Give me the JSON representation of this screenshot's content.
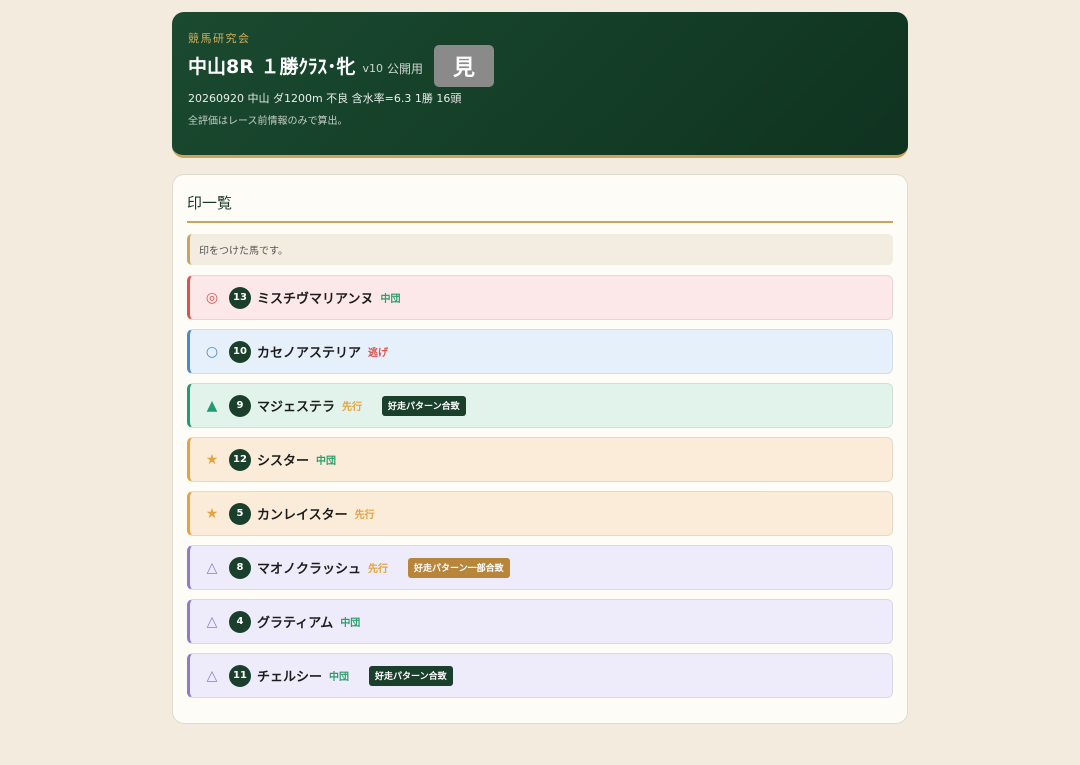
{
  "header": {
    "site_name": "競馬研究会",
    "race_title": "中山8R １勝ｸﾗｽ･牝",
    "version": "v10",
    "visibility": "公開用",
    "view_button_label": "見",
    "race_info": "20260920 中山 ダ1200m 不良 含水率=6.3 1勝 16頭",
    "note": "全評価はレース前情報のみで算出。"
  },
  "marks_section": {
    "title": "印一覧",
    "notice": "印をつけた馬です。"
  },
  "horses": [
    {
      "mark": "◎",
      "number": "13",
      "name": "ミスチヴマリアンヌ",
      "style": "中団",
      "tag": "",
      "mark_color": "#d9534f",
      "style_color": "#2e9e6b",
      "bg": "#fce8e8",
      "border": "#d9534f",
      "tag_color": ""
    },
    {
      "mark": "○",
      "number": "10",
      "name": "カセノアステリア",
      "style": "逃げ",
      "tag": "",
      "mark_color": "#4a89c8",
      "style_color": "#d9534f",
      "bg": "#e6f0fa",
      "border": "#4a89c8",
      "tag_color": ""
    },
    {
      "mark": "▲",
      "number": "9",
      "name": "マジェステラ",
      "style": "先行",
      "tag": "好走パターン合致",
      "mark_color": "#229a73",
      "style_color": "#e6a23c",
      "bg": "#e2f3ec",
      "border": "#229a73",
      "tag_color": "#1a3f2b"
    },
    {
      "mark": "★",
      "number": "12",
      "name": "シスター",
      "style": "中団",
      "tag": "",
      "mark_color": "#e6a23c",
      "style_color": "#2e9e6b",
      "bg": "#faecd9",
      "border": "#e6a23c",
      "tag_color": ""
    },
    {
      "mark": "★",
      "number": "5",
      "name": "カンレイスター",
      "style": "先行",
      "tag": "",
      "mark_color": "#e6a23c",
      "style_color": "#e6a23c",
      "bg": "#faecd9",
      "border": "#e6a23c",
      "tag_color": ""
    },
    {
      "mark": "△",
      "number": "8",
      "name": "マオノクラッシュ",
      "style": "先行",
      "tag": "好走パターン一部合致",
      "mark_color": "#8a7dc8",
      "style_color": "#e6a23c",
      "bg": "#eeebfa",
      "border": "#8a7dc8",
      "tag_color": "#b8863b"
    },
    {
      "mark": "△",
      "number": "4",
      "name": "グラティアム",
      "style": "中団",
      "tag": "",
      "mark_color": "#8a7dc8",
      "style_color": "#2e9e6b",
      "bg": "#eeebfa",
      "border": "#8a7dc8",
      "tag_color": ""
    },
    {
      "mark": "△",
      "number": "11",
      "name": "チェルシー",
      "style": "中団",
      "tag": "好走パターン合致",
      "mark_color": "#8a7dc8",
      "style_color": "#2e9e6b",
      "bg": "#eeebfa",
      "border": "#8a7dc8",
      "tag_color": "#1a3f2b"
    }
  ]
}
